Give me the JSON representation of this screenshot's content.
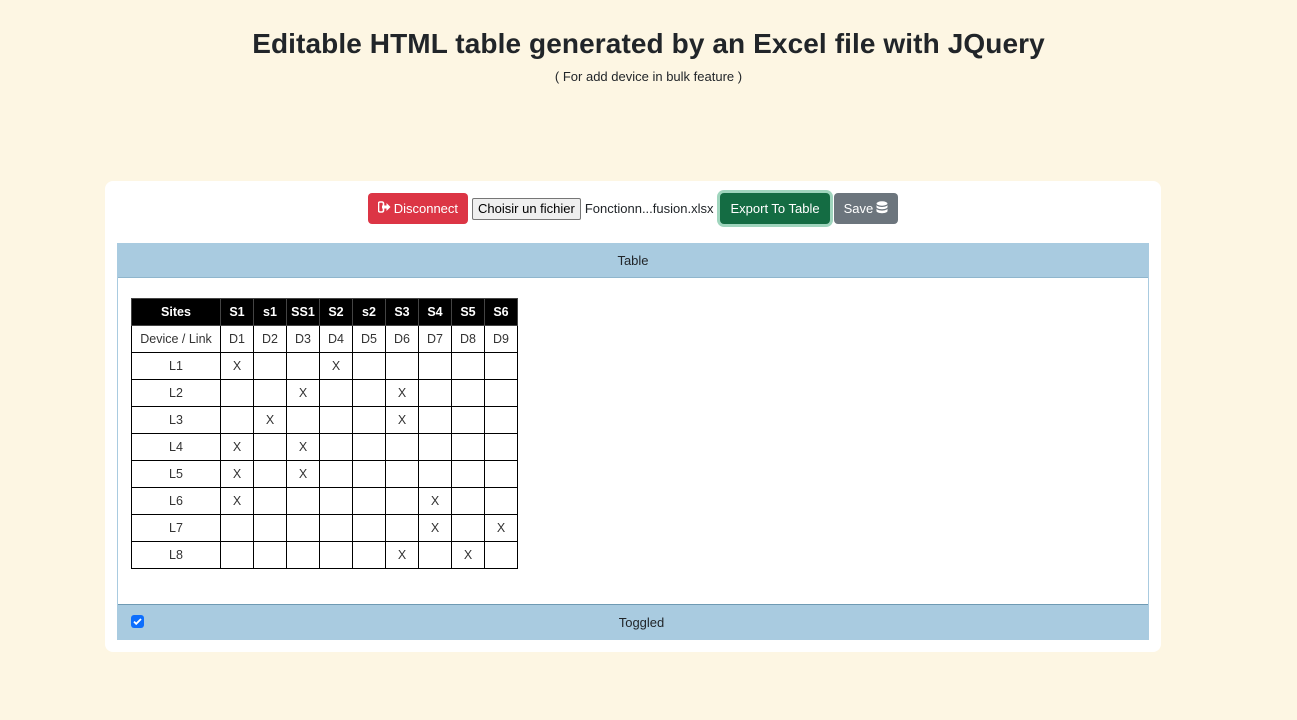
{
  "header": {
    "title": "Editable HTML table generated by an Excel file with JQuery",
    "subtitle": "( For add device in bulk feature )"
  },
  "toolbar": {
    "disconnect_label": "Disconnect",
    "file_button_label": "Choisir un fichier",
    "file_name": "Fonctionn...fusion.xlsx",
    "export_label": "Export To Table",
    "save_label": "Save"
  },
  "colors": {
    "background": "#fdf6e3",
    "danger": "#dc3545",
    "success": "#146c43",
    "secondary": "#6c757d",
    "panel_header": "#a9cbe0",
    "checkbox": "#0d6efd"
  },
  "panel": {
    "header_label": "Table",
    "footer_label": "Toggled",
    "toggle_checked": true
  },
  "table": {
    "headers": [
      "Sites",
      "S1",
      "s1",
      "SS1",
      "S2",
      "s2",
      "S3",
      "S4",
      "S5",
      "S6"
    ],
    "rows": [
      [
        "Device / Link",
        "D1",
        "D2",
        "D3",
        "D4",
        "D5",
        "D6",
        "D7",
        "D8",
        "D9"
      ],
      [
        "L1",
        "X",
        "",
        "",
        "X",
        "",
        "",
        "",
        "",
        ""
      ],
      [
        "L2",
        "",
        "",
        "X",
        "",
        "",
        "X",
        "",
        "",
        ""
      ],
      [
        "L3",
        "",
        "X",
        "",
        "",
        "",
        "X",
        "",
        "",
        ""
      ],
      [
        "L4",
        "X",
        "",
        "X",
        "",
        "",
        "",
        "",
        "",
        ""
      ],
      [
        "L5",
        "X",
        "",
        "X",
        "",
        "",
        "",
        "",
        "",
        ""
      ],
      [
        "L6",
        "X",
        "",
        "",
        "",
        "",
        "",
        "X",
        "",
        ""
      ],
      [
        "L7",
        "",
        "",
        "",
        "",
        "",
        "",
        "X",
        "",
        "X"
      ],
      [
        "L8",
        "",
        "",
        "",
        "",
        "",
        "X",
        "",
        "X",
        ""
      ]
    ]
  }
}
